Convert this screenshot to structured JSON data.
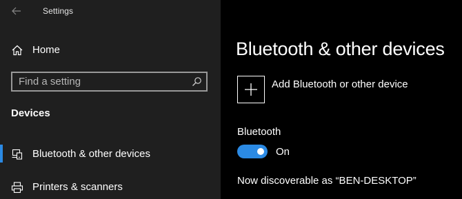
{
  "app": {
    "title": "Settings"
  },
  "sidebar": {
    "home_label": "Home",
    "search": {
      "placeholder": "Find a setting",
      "value": ""
    },
    "section_heading": "Devices",
    "items": [
      {
        "label": "Bluetooth & other devices",
        "icon": "bluetooth-devices-icon",
        "selected": true
      },
      {
        "label": "Printers & scanners",
        "icon": "printer-icon",
        "selected": false
      }
    ]
  },
  "main": {
    "title": "Bluetooth & other devices",
    "add_device_label": "Add Bluetooth or other device",
    "bluetooth": {
      "label": "Bluetooth",
      "state_label": "On",
      "enabled": true
    },
    "discoverable_text": "Now discoverable as “BEN-DESKTOP”"
  },
  "colors": {
    "accent": "#2b8ae4",
    "sidebar_bg": "#1f1f1f",
    "main_bg": "#000000"
  }
}
